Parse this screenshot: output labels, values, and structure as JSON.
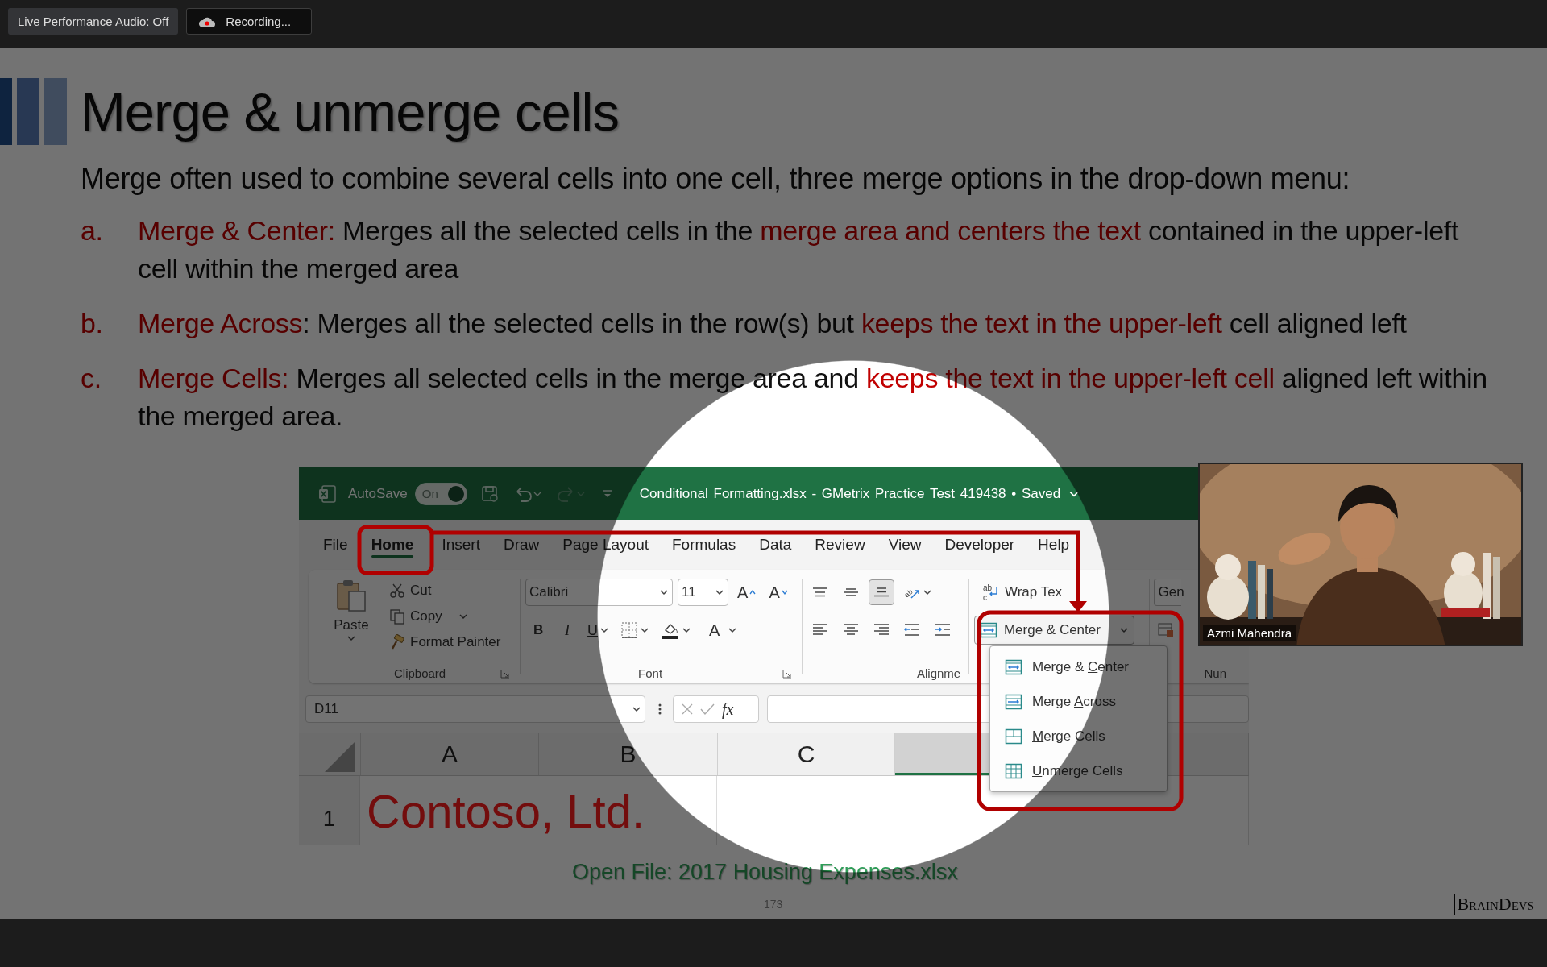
{
  "top_bar": {
    "buttons": [
      {
        "kind": "audio",
        "label": "Live Performance Audio: Off"
      },
      {
        "kind": "recording",
        "label": "Recording..."
      }
    ]
  },
  "slide": {
    "title": "Merge & unmerge cells",
    "intro": "Merge often used to combine several cells into one cell, three merge options in the drop-down menu:",
    "items": [
      {
        "marker": "a.",
        "segments": [
          {
            "text": "Merge & Center:",
            "highlighted": true
          },
          {
            "text": " Merges all the selected cells in the ",
            "highlighted": false
          },
          {
            "text": "merge area and centers the text",
            "highlighted": true
          },
          {
            "text": " contained in the upper-left cell within the merged area",
            "highlighted": false
          }
        ]
      },
      {
        "marker": "b.",
        "segments": [
          {
            "text": "Merge Across",
            "highlighted": true
          },
          {
            "text": ": Merges all the selected cells in the row(s) but ",
            "highlighted": false
          },
          {
            "text": "keeps the text in the upper-left",
            "highlighted": true
          },
          {
            "text": " cell aligned left",
            "highlighted": false
          }
        ]
      },
      {
        "marker": "c.",
        "segments": [
          {
            "text": "Merge Cells:",
            "highlighted": true
          },
          {
            "text": " Merges all selected cells in the merge area and ",
            "highlighted": false
          },
          {
            "text": "keeps the text in the upper-left cell",
            "highlighted": true
          },
          {
            "text": " aligned left within the merged area.",
            "highlighted": false
          }
        ]
      }
    ],
    "excel": {
      "title_bar": {
        "autosave_label": "AutoSave",
        "autosave_toggle": {
          "label": "On",
          "on": true
        },
        "document_title": "Conditional Formatting.xlsx - GMetrix Practice Test 419438 • Saved"
      },
      "tabs": [
        {
          "label": "File",
          "selected": false
        },
        {
          "label": "Home",
          "selected": true
        },
        {
          "label": "Insert",
          "selected": false
        },
        {
          "label": "Draw",
          "selected": false
        },
        {
          "label": "Page Layout",
          "selected": false
        },
        {
          "label": "Formulas",
          "selected": false
        },
        {
          "label": "Data",
          "selected": false
        },
        {
          "label": "Review",
          "selected": false
        },
        {
          "label": "View",
          "selected": false
        },
        {
          "label": "Developer",
          "selected": false
        },
        {
          "label": "Help",
          "selected": false
        }
      ],
      "clipboard": {
        "paste": "Paste",
        "cut": "Cut",
        "copy": "Copy",
        "format_painter": "Format Painter",
        "label": "Clipboard"
      },
      "font": {
        "font_name": "Calibri",
        "font_size": "11",
        "grow": "A",
        "shrink": "A",
        "bold": "B",
        "italic": "I",
        "underline": "U",
        "font_color": "A",
        "label": "Font"
      },
      "alignment": {
        "label": "Alignme",
        "top_row": [
          {
            "kind": "align-top",
            "selected": false
          },
          {
            "kind": "align-middle",
            "selected": false
          },
          {
            "kind": "align-bottom",
            "selected": true
          },
          {
            "kind": "orientation",
            "selected": false,
            "glyph": "ab"
          }
        ],
        "bottom_row": [
          {
            "kind": "align-left",
            "selected": false
          },
          {
            "kind": "align-center",
            "selected": false
          },
          {
            "kind": "align-right",
            "selected": false
          },
          {
            "kind": "indent-decrease",
            "selected": false
          },
          {
            "kind": "indent-increase",
            "selected": false
          }
        ]
      },
      "wrap_icon_glyphs": [
        "ab",
        "c"
      ],
      "wrap_text": "Wrap Tex",
      "merge_button": "Merge & Center",
      "number": {
        "format_field": "Gen",
        "label": "Nun"
      },
      "merge_menu": [
        {
          "kind": "merge-center",
          "before": "Merge & ",
          "key": "C",
          "after": "enter"
        },
        {
          "kind": "merge-across",
          "before": "Merge ",
          "key": "A",
          "after": "cross"
        },
        {
          "kind": "merge-cells",
          "key": "M",
          "after": "erge Cells"
        },
        {
          "kind": "unmerge",
          "key": "U",
          "after": "nmerge Cells"
        }
      ],
      "formula_bar": {
        "name_box": "D11",
        "function_label": "fx"
      },
      "columns": [
        {
          "label": "A",
          "selected": false
        },
        {
          "label": "B",
          "selected": false
        },
        {
          "label": "C",
          "selected": false
        },
        {
          "selected": true
        }
      ],
      "rows": [
        {
          "header": "1",
          "cells": [
            "Contoso, Ltd."
          ]
        }
      ]
    },
    "caption": "Open File: 2017 Housing Expenses.xlsx",
    "page_number": "173",
    "logo": "BrainDevs"
  },
  "video": {
    "name": "Azmi Mahendra"
  }
}
